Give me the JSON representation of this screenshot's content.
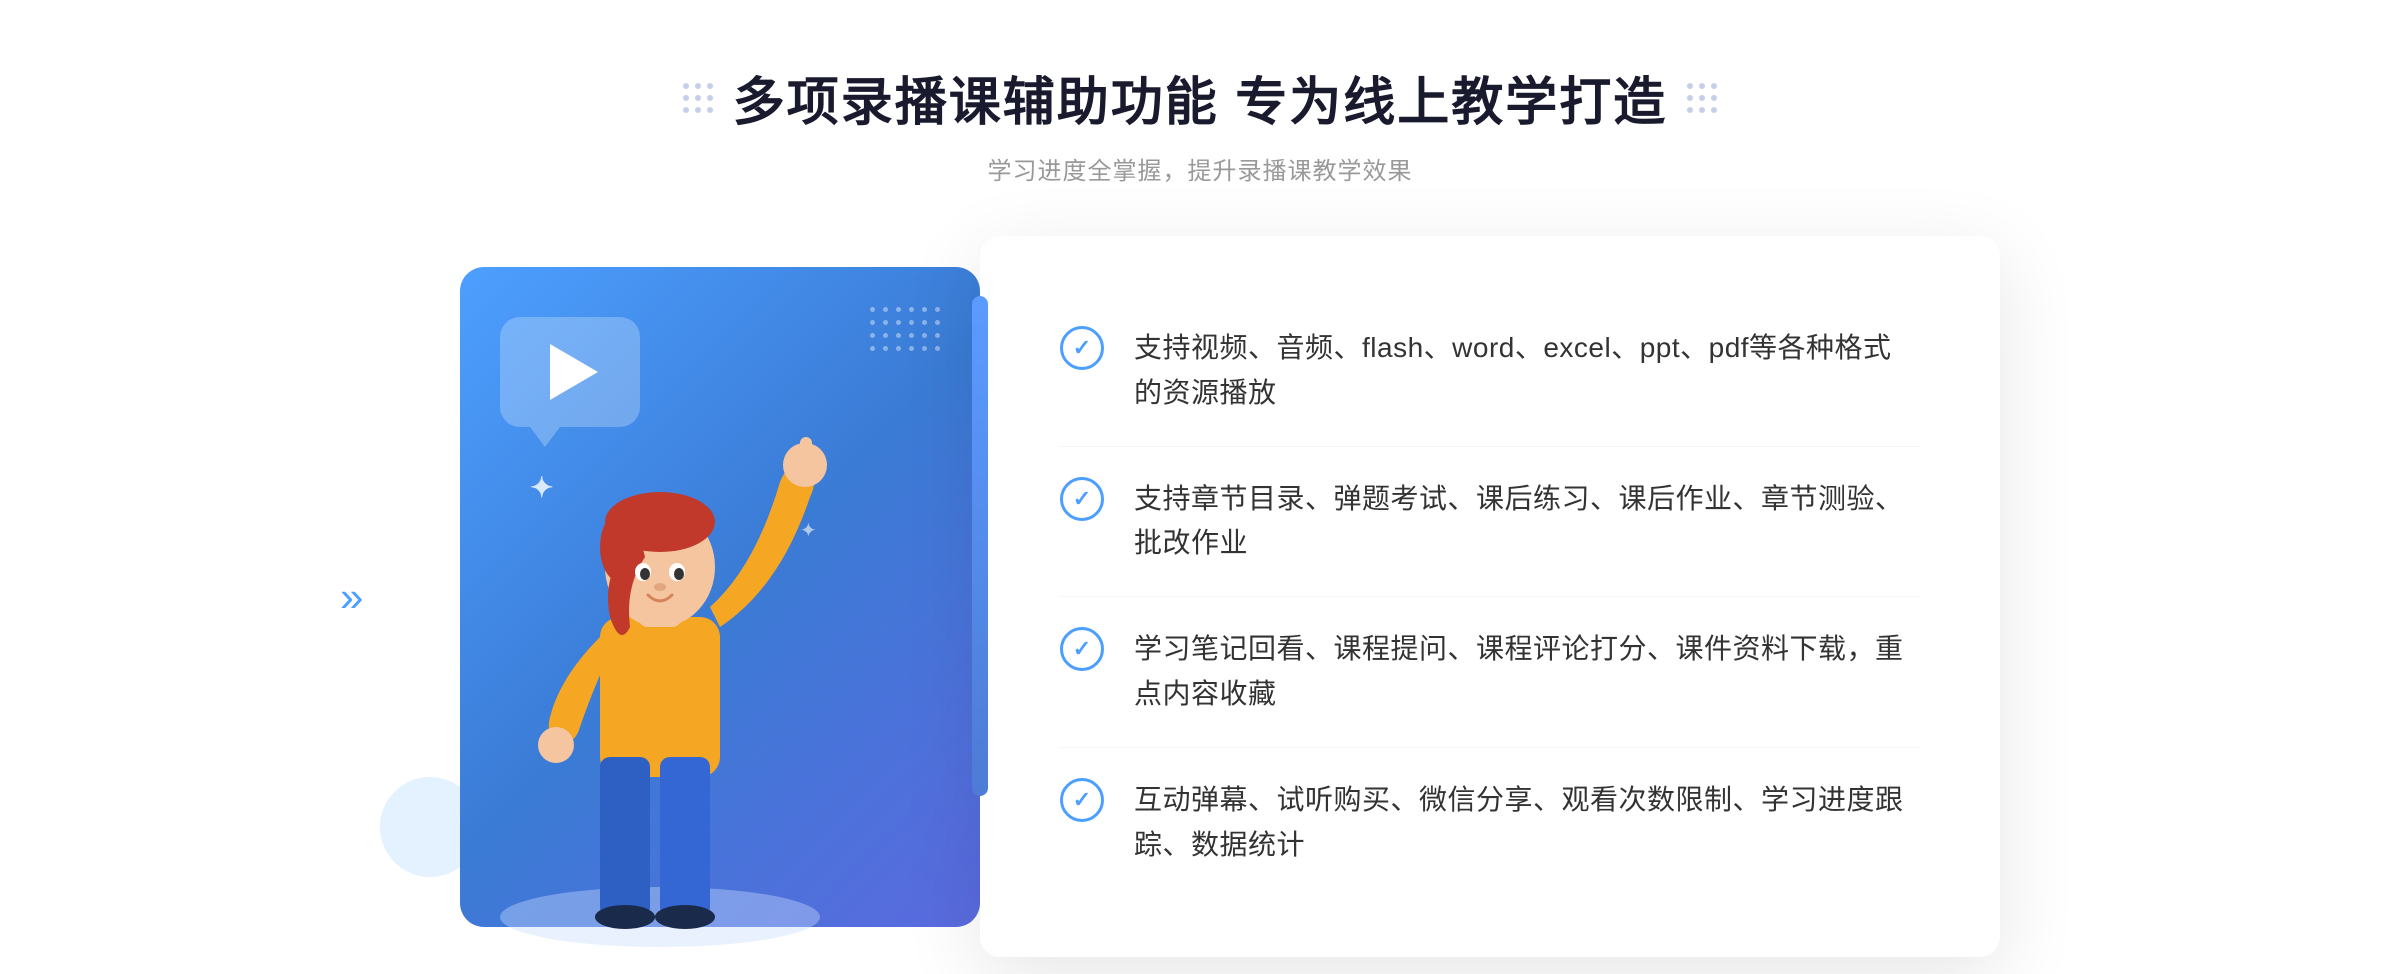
{
  "header": {
    "main_title": "多项录播课辅助功能 专为线上教学打造",
    "subtitle": "学习进度全掌握，提升录播课教学效果"
  },
  "features": [
    {
      "id": 1,
      "text": "支持视频、音频、flash、word、excel、ppt、pdf等各种格式的资源播放"
    },
    {
      "id": 2,
      "text": "支持章节目录、弹题考试、课后练习、课后作业、章节测验、批改作业"
    },
    {
      "id": 3,
      "text": "学习笔记回看、课程提问、课程评论打分、课件资料下载，重点内容收藏"
    },
    {
      "id": 4,
      "text": "互动弹幕、试听购买、微信分享、观看次数限制、学习进度跟踪、数据统计"
    }
  ],
  "decorators": {
    "left_arrows": "«",
    "check_mark": "✓"
  }
}
